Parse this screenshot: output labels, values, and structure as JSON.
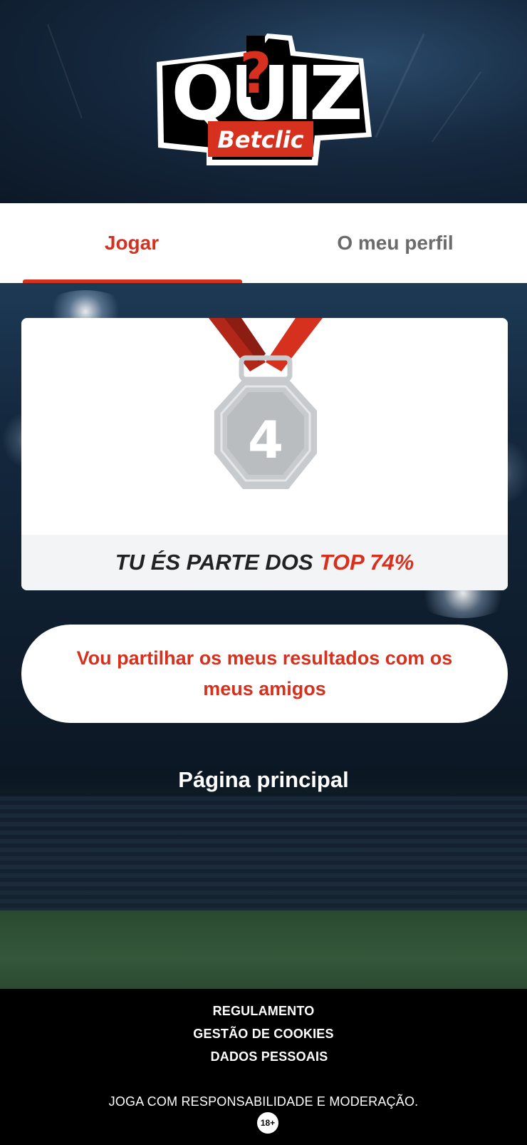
{
  "brand": {
    "logo_title": "QUIZ",
    "logo_sub": "Betclic"
  },
  "tabs": [
    {
      "label": "Jogar",
      "active": true
    },
    {
      "label": "O meu perfil",
      "active": false
    }
  ],
  "result": {
    "medal_rank": "4",
    "banner_prefix": "TU ÉS PARTE DOS",
    "banner_highlight": "TOP 74%"
  },
  "actions": {
    "share_label": "Vou partilhar os meus resultados com os meus amigos",
    "home_label": "Página principal"
  },
  "footer": {
    "links": [
      "REGULAMENTO",
      "GESTÃO DE COOKIES",
      "DADOS PESSOAIS"
    ],
    "note": "JOGA COM RESPONSABILIDADE E MODERAÇÃO.",
    "age_badge": "18+"
  },
  "colors": {
    "accent": "#d6301e",
    "tab_inactive": "#6b6b6b",
    "footer_bg": "#000000",
    "banner_bg": "#f3f4f6"
  }
}
